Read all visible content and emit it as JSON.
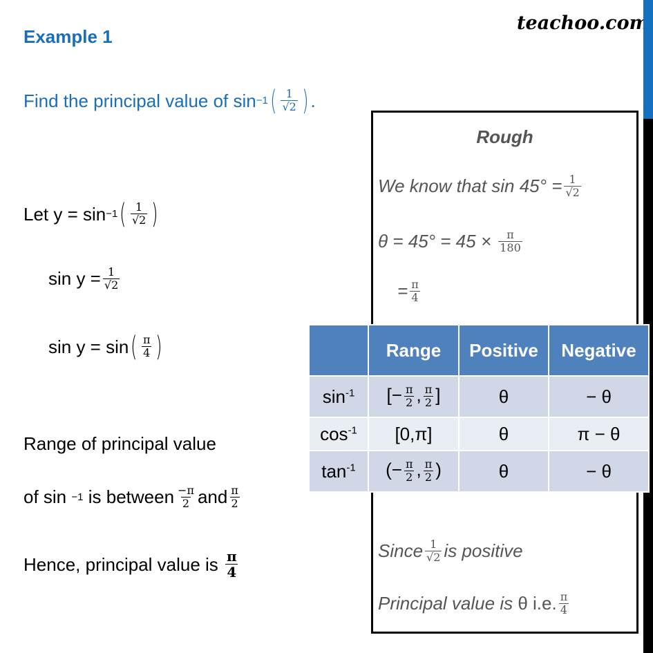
{
  "header": {
    "title": "Example 1",
    "logo": "teachoo.com"
  },
  "colors": {
    "accent_blue": "#1a6eb8",
    "table_header": "#4f81bd",
    "table_row_dark": "#d0d8e8",
    "table_row_light": "#e9edf4",
    "rough_text": "#555555"
  },
  "question": {
    "prefix": "Find the principal value of sin",
    "sup": "−1",
    "frac_num": "1",
    "frac_den": "√2",
    "suffix": "."
  },
  "solution": {
    "line1": {
      "prefix": "Let y = sin",
      "sup": "−1",
      "frac_num": "1",
      "frac_den": "√2"
    },
    "line2": {
      "prefix": "sin y =",
      "frac_num": "1",
      "frac_den": "√2"
    },
    "line3": {
      "prefix": "sin y = sin",
      "frac_num": "π",
      "frac_den": "4"
    },
    "line4": {
      "text": "Range of principal value"
    },
    "line5": {
      "prefix": "of sin",
      "sup": "−1",
      "middle": "is between",
      "frac1_num": "−π",
      "frac1_den": "2",
      "and": "and",
      "frac2_num": "π",
      "frac2_den": "2"
    },
    "line6": {
      "prefix": "Hence, principal value is",
      "frac_num": "π",
      "frac_den": "4"
    }
  },
  "rough": {
    "title": "Rough",
    "line1": {
      "prefix": "We know that sin 45° =",
      "frac_num": "1",
      "frac_den": "√2"
    },
    "line2": {
      "prefix": "θ = 45° = 45  ×",
      "frac_num": "π",
      "frac_den": "180"
    },
    "line3": {
      "prefix": "=",
      "frac_num": "π",
      "frac_den": "4"
    },
    "line4": {
      "prefix": "Since",
      "frac_num": "1",
      "frac_den": "√2",
      "suffix": "is positive"
    },
    "line5": {
      "prefix": "Principal value is",
      "theta": "θ i.e.",
      "frac_num": "π",
      "frac_den": "4"
    }
  },
  "table": {
    "headers": [
      "",
      "Range",
      "Positive",
      "Negative"
    ],
    "rows": [
      {
        "func": "sin",
        "sup": "-1",
        "range_open": "[−",
        "range_close": "]",
        "frac_num": "π",
        "frac_den": "2",
        "positive": "θ",
        "negative": "− θ"
      },
      {
        "func": "cos",
        "sup": "-1",
        "range": "[0,π]",
        "positive": "θ",
        "negative": "π − θ"
      },
      {
        "func": "tan",
        "sup": "-1",
        "range_open": "(−",
        "range_close": ")",
        "frac_num": "π",
        "frac_den": "2",
        "positive": "θ",
        "negative": "− θ"
      }
    ]
  }
}
